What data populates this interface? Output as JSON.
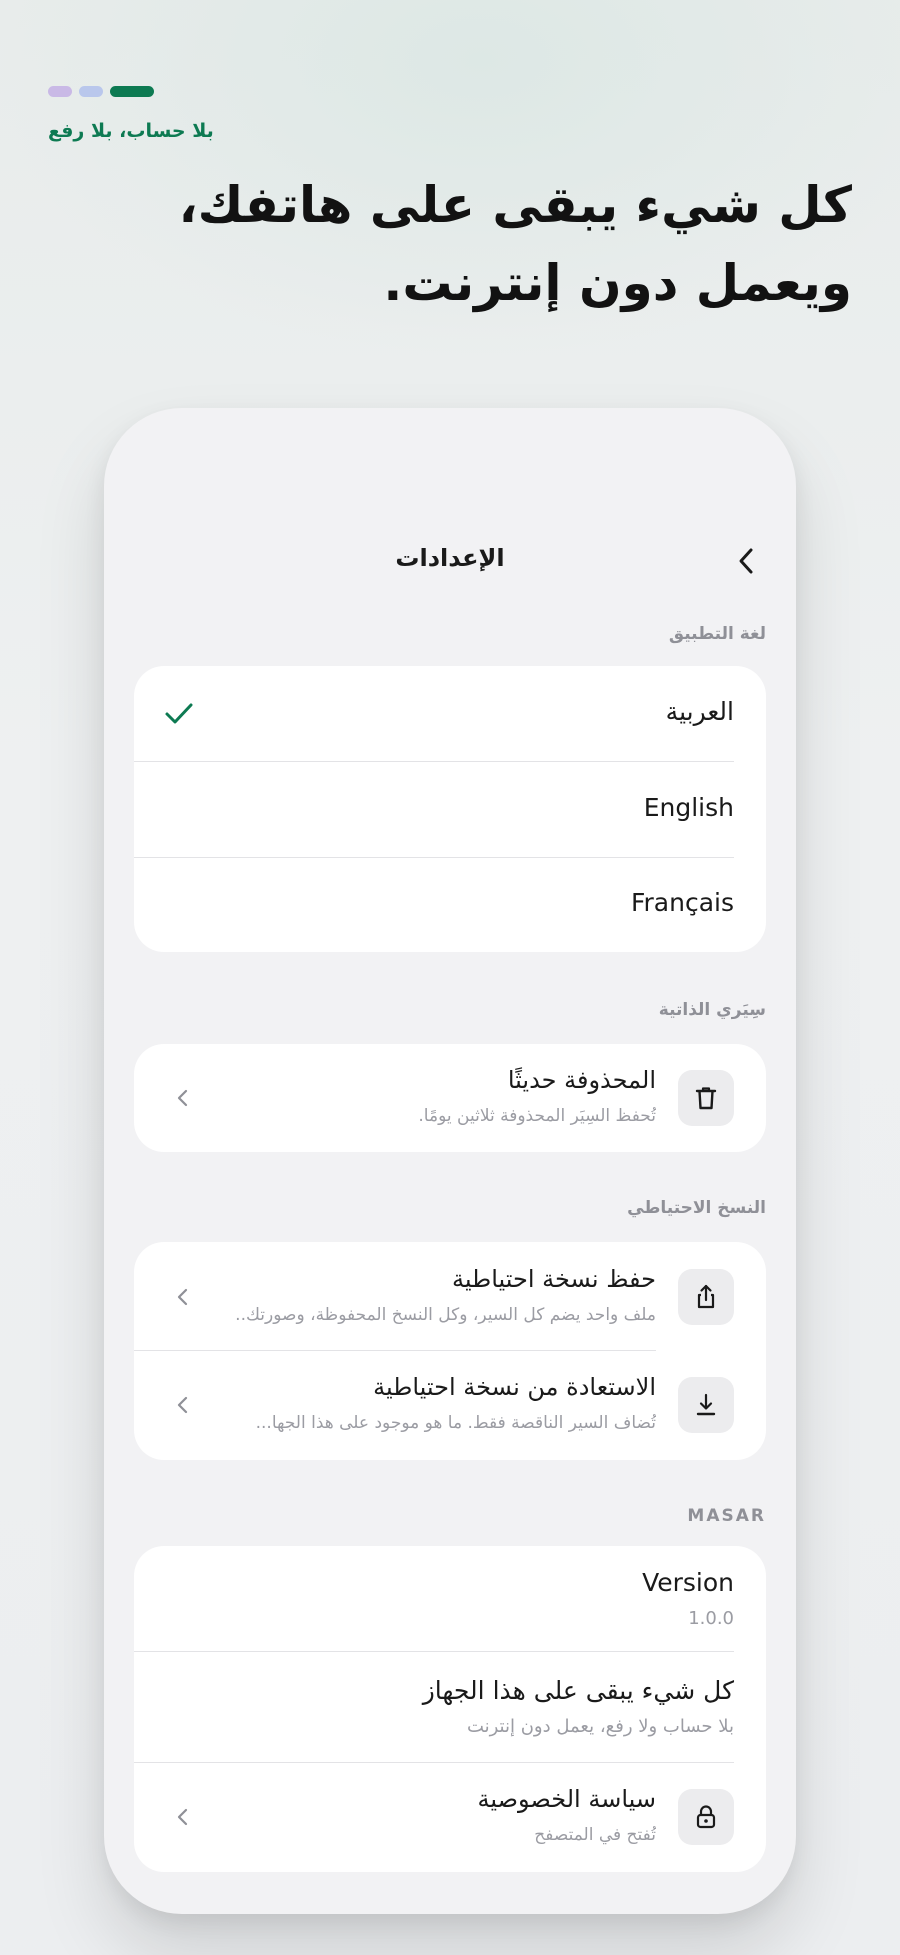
{
  "colors": {
    "accent": "#0d7a52",
    "dot_1": "#c9b9e6",
    "dot_2": "#b9c7ec",
    "dot_3": "#0d7a52"
  },
  "hero": {
    "tag": "بلا حساب، بلا رفع",
    "headline": "كل شيء يبقى على هاتفك، ويعمل دون إنترنت."
  },
  "screen": {
    "title": "الإعدادات",
    "back_icon": "chevron-left-icon"
  },
  "language": {
    "section_label": "لغة التطبيق",
    "options": [
      {
        "label": "العربية",
        "selected": true
      },
      {
        "label": "English",
        "selected": false
      },
      {
        "label": "Français",
        "selected": false
      }
    ]
  },
  "my_cvs": {
    "section_label": "سِيَري الذاتية",
    "items": [
      {
        "icon": "trash-icon",
        "title": "المحذوفة حديثًا",
        "subtitle": "تُحفظ السِيَر المحذوفة ثلاثين يومًا."
      }
    ]
  },
  "backup": {
    "section_label": "النسخ الاحتياطي",
    "items": [
      {
        "icon": "share-icon",
        "title": "حفظ نسخة احتياطية",
        "subtitle": "ملف واحد يضم كل السير، وكل النسخ المحفوظة، وصورتك..."
      },
      {
        "icon": "download-icon",
        "title": "الاستعادة من نسخة احتياطية",
        "subtitle": "تُضاف السير الناقصة فقط. ما هو موجود على هذا الجها..."
      }
    ]
  },
  "about": {
    "section_label": "MASAR",
    "version_label": "Version",
    "version_value": "1.0.0",
    "device_title": "كل شيء يبقى على هذا الجهاز",
    "device_subtitle": "بلا حساب ولا رفع، يعمل دون إنترنت",
    "privacy": {
      "icon": "lock-icon",
      "title": "سياسة الخصوصية",
      "subtitle": "تُفتح في المتصفح"
    }
  }
}
